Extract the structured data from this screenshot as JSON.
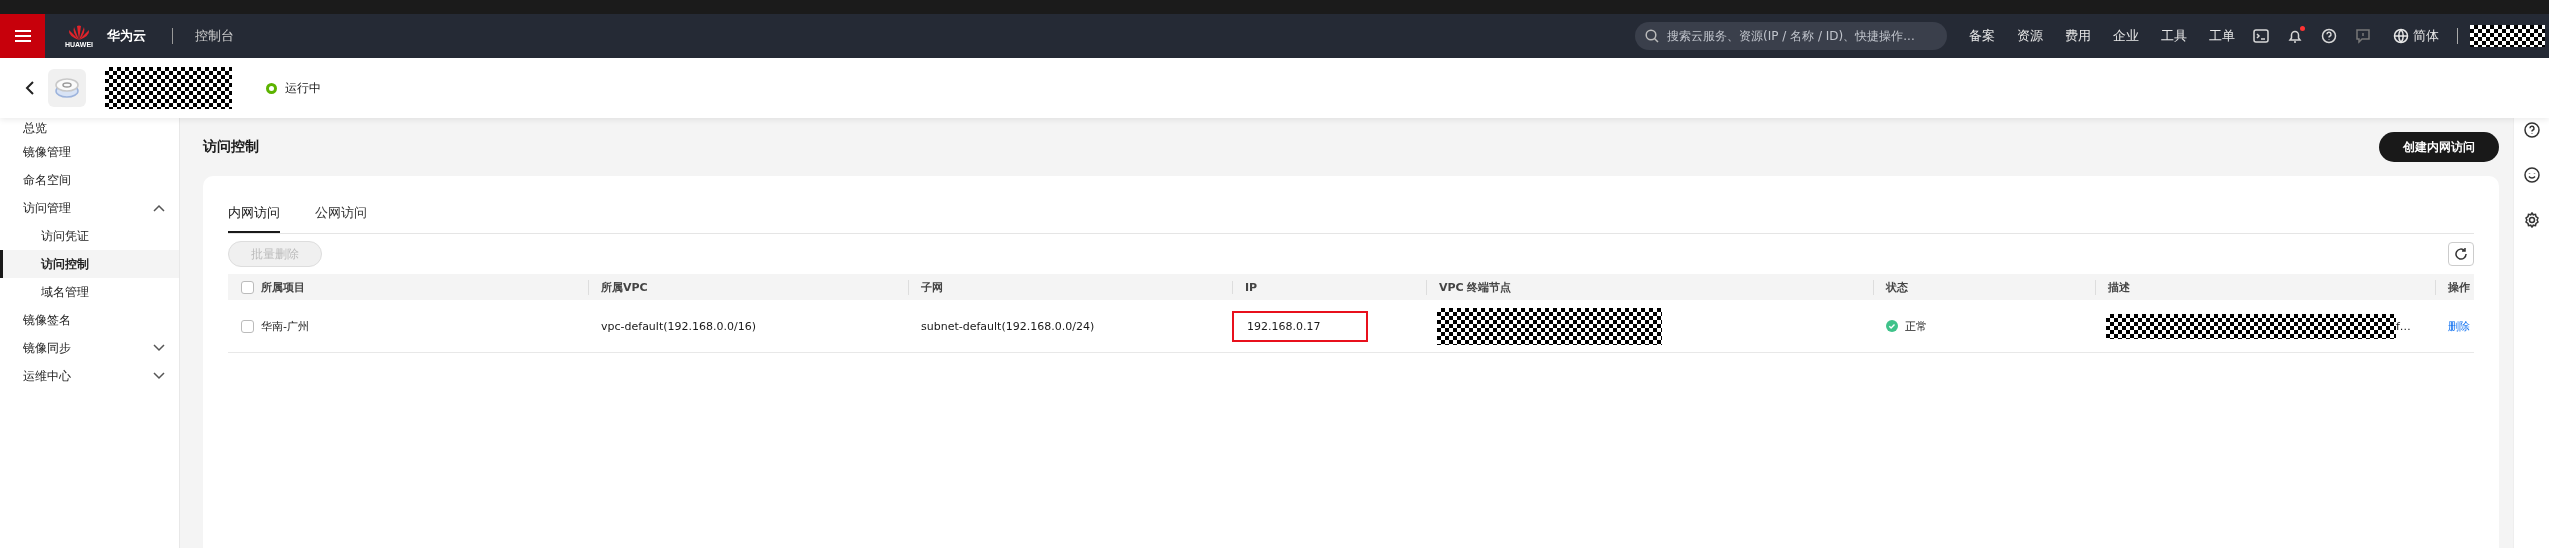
{
  "topbar": {
    "brand": "华为云",
    "logo_text": "HUAWEI",
    "console": "控制台",
    "search": {
      "placeholder": "搜索云服务、资源(IP / 名称 / ID)、快捷操作..."
    },
    "links": [
      "备案",
      "资源",
      "费用",
      "企业",
      "工具",
      "工单"
    ],
    "notification_dot": true,
    "language": "简体"
  },
  "instance": {
    "status": "运行中"
  },
  "sidebar": {
    "items": [
      {
        "label": "总览",
        "selected": false
      },
      {
        "label": "镜像管理",
        "selected": false
      },
      {
        "label": "命名空间",
        "selected": false
      },
      {
        "label": "访问管理",
        "selected": false,
        "expanded": true,
        "children": [
          {
            "label": "访问凭证",
            "selected": false
          },
          {
            "label": "访问控制",
            "selected": true
          },
          {
            "label": "域名管理",
            "selected": false
          }
        ]
      },
      {
        "label": "镜像签名",
        "selected": false
      },
      {
        "label": "镜像同步",
        "selected": false,
        "expanded": false
      },
      {
        "label": "运维中心",
        "selected": false,
        "expanded": false
      }
    ]
  },
  "page": {
    "title": "访问控制",
    "create_button": "创建内网访问"
  },
  "tabs": [
    {
      "label": "内网访问",
      "selected": true
    },
    {
      "label": "公网访问",
      "selected": false
    }
  ],
  "batch_delete": {
    "label": "批量删除",
    "disabled": true
  },
  "table": {
    "all_checked": false,
    "columns": [
      "所属项目",
      "所属VPC",
      "子网",
      "IP",
      "VPC 终端节点",
      "状态",
      "描述",
      "操作"
    ],
    "rows": [
      {
        "checked": false,
        "project": "华南-广州",
        "vpc": "vpc-default(192.168.0.0/16)",
        "subnet": "subnet-default(192.168.0.0/24)",
        "ip": "192.168.0.17",
        "ip_highlighted": true,
        "status": "正常",
        "color": "#3fc28a",
        "description_tail": "f…",
        "action": "删除"
      }
    ]
  }
}
